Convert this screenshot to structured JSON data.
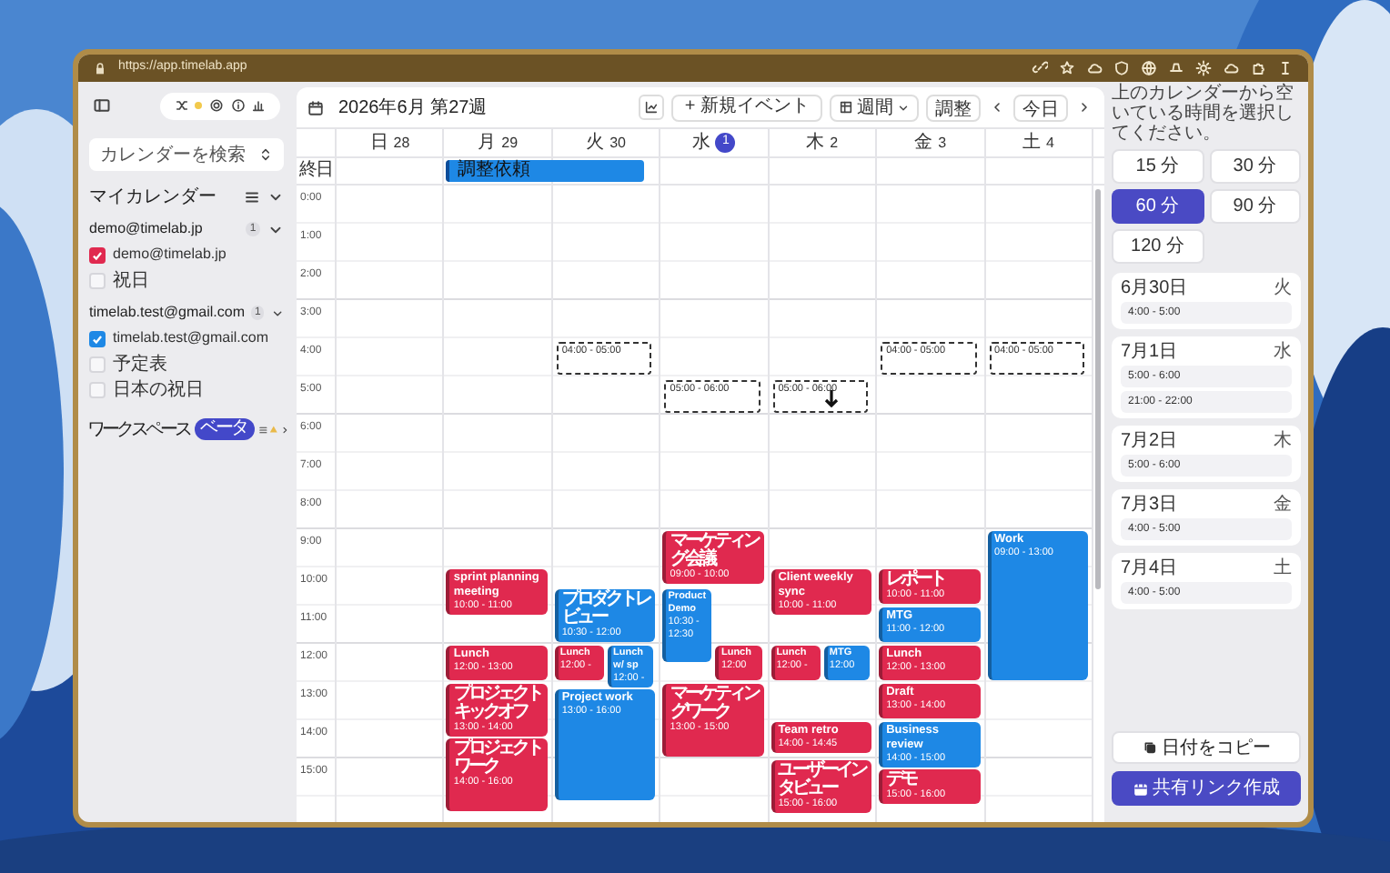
{
  "browser": {
    "url": "https://app.timelab.app"
  },
  "sidebar": {
    "search": {
      "placeholder": "カレンダーを検索"
    },
    "my_calendars": "マイカレンダー",
    "accounts": [
      {
        "email": "demo@timelab.jp",
        "count": "1",
        "expanded": true,
        "calendars": [
          {
            "name": "demo@timelab.jp",
            "checked": true,
            "color": "#e0294f"
          },
          {
            "name": "祝日",
            "checked": false
          }
        ]
      },
      {
        "email": "timelab.test@gmail.com",
        "count": "1",
        "expanded": true,
        "calendars": [
          {
            "name": "timelab.test@gmail.com",
            "checked": true,
            "color": "#1e88e5"
          },
          {
            "name": "予定表",
            "checked": false
          },
          {
            "name": "日本の祝日",
            "checked": false
          }
        ]
      }
    ],
    "workspace": {
      "label": "ワークスペース",
      "badge": "ベータ"
    }
  },
  "calendar": {
    "title": "2026年6月 第27週",
    "toolbar": {
      "new_event": "+ 新規イベント",
      "view": "週間",
      "adjust": "調整",
      "today": "今日"
    },
    "all_day_label": "終日",
    "hours": [
      "0:00",
      "1:00",
      "2:00",
      "3:00",
      "4:00",
      "5:00",
      "6:00",
      "7:00",
      "8:00",
      "9:00",
      "10:00",
      "11:00",
      "12:00",
      "13:00",
      "14:00",
      "15:00"
    ],
    "days": [
      {
        "weekday": "日",
        "date": "28",
        "today": false
      },
      {
        "weekday": "月",
        "date": "29",
        "today": false,
        "all_day": [
          {
            "title": "調整依頼",
            "color": "#1e88e5",
            "continues": true
          }
        ],
        "events": [
          {
            "title": "sprint planning meeting",
            "time": "10:00 - 11:00",
            "kind": "full",
            "color": "#e0294f"
          },
          {
            "title": "Lunch",
            "time": "12:00 - 13:00",
            "kind": "full",
            "color": "#e0294f"
          },
          {
            "title": "プロジェクトキックオフ",
            "time": "13:00 - 14:00",
            "kind": "full",
            "color": "#e0294f"
          },
          {
            "title": "プロジェクトワーク",
            "time": "14:00 - 16:00",
            "kind": "full",
            "color": "#e0294f"
          }
        ]
      },
      {
        "weekday": "火",
        "date": "30",
        "today": false,
        "slots": [
          {
            "label": "04:00 - 05:00",
            "hovered": false
          }
        ],
        "events": [
          {
            "title": "プロダクトレビュー",
            "time": "10:30 - 12:00",
            "kind": "full",
            "color": "#1e88e5"
          },
          {
            "title": "Lunch",
            "time": "12:00 -",
            "kind": "left",
            "color": "#e0294f"
          },
          {
            "title": "Lunch w/ sp",
            "time": "12:00 -",
            "kind": "right",
            "color": "#1e88e5"
          },
          {
            "title": "Project work",
            "time": "13:00 - 16:00",
            "kind": "full",
            "color": "#1e88e5"
          }
        ]
      },
      {
        "weekday": "水",
        "date": "1",
        "today": true,
        "slots": [
          {
            "label": "05:00 - 06:00",
            "hovered": false
          }
        ],
        "events": [
          {
            "title": "マーケティング会議",
            "time": "09:00 - 10:00",
            "kind": "full",
            "color": "#e0294f"
          },
          {
            "title": "Product Demo",
            "time": "10:30 - 12:30",
            "kind": "left",
            "color": "#1e88e5"
          },
          {
            "title": "Lunch",
            "time": "12:00",
            "kind": "right",
            "color": "#e0294f"
          },
          {
            "title": "マーケティングワーク",
            "time": "13:00 - 15:00",
            "kind": "full",
            "color": "#e0294f"
          }
        ]
      },
      {
        "weekday": "木",
        "date": "2",
        "today": false,
        "slots": [
          {
            "label": "05:00 - 06:00",
            "hovered": true
          }
        ],
        "events": [
          {
            "title": "Client weekly sync",
            "time": "10:00 - 11:00",
            "kind": "full",
            "color": "#e0294f"
          },
          {
            "title": "Lunch",
            "time": "12:00 -",
            "kind": "left",
            "color": "#e0294f"
          },
          {
            "title": "MTG",
            "time": "12:00",
            "kind": "right",
            "color": "#1e88e5"
          },
          {
            "title": "Team retro",
            "time": "14:00 - 14:45",
            "kind": "full",
            "color": "#e0294f"
          },
          {
            "title": "ユーザーインタビュー",
            "time": "15:00 - 16:00",
            "kind": "full",
            "color": "#e0294f"
          }
        ]
      },
      {
        "weekday": "金",
        "date": "3",
        "today": false,
        "slots": [
          {
            "label": "04:00 - 05:00",
            "hovered": false
          }
        ],
        "events": [
          {
            "title": "レポート",
            "time": "10:00 - 11:00",
            "kind": "full",
            "color": "#e0294f"
          },
          {
            "title": "MTG",
            "time": "11:00 - 12:00",
            "kind": "full",
            "color": "#1e88e5"
          },
          {
            "title": "Lunch",
            "time": "12:00 - 13:00",
            "kind": "full",
            "color": "#e0294f"
          },
          {
            "title": "Draft",
            "time": "13:00 - 14:00",
            "kind": "full",
            "color": "#e0294f"
          },
          {
            "title": "Business review",
            "time": "14:00 - 15:00",
            "kind": "full",
            "color": "#1e88e5"
          },
          {
            "title": "デモ",
            "time": "15:00 - 16:00",
            "kind": "full",
            "color": "#e0294f"
          }
        ]
      },
      {
        "weekday": "土",
        "date": "4",
        "today": false,
        "slots": [
          {
            "label": "04:00 - 05:00",
            "hovered": false
          }
        ],
        "events": [
          {
            "title": "Work",
            "time": "09:00 - 13:00",
            "kind": "full",
            "color": "#1e88e5"
          }
        ]
      }
    ]
  },
  "scheduler": {
    "hint": "上のカレンダーから空いている時間を選択してください。",
    "durations": [
      {
        "label": "15 分",
        "selected": false
      },
      {
        "label": "30 分",
        "selected": false
      },
      {
        "label": "60 分",
        "selected": true
      },
      {
        "label": "90 分",
        "selected": false
      },
      {
        "label": "120 分",
        "selected": false
      }
    ],
    "days": [
      {
        "date": "6月30日",
        "weekday": "火",
        "slots": [
          "4:00 - 5:00"
        ]
      },
      {
        "date": "7月1日",
        "weekday": "水",
        "slots": [
          "5:00 - 6:00",
          "21:00 - 22:00"
        ]
      },
      {
        "date": "7月2日",
        "weekday": "木",
        "slots": [
          "5:00 - 6:00"
        ]
      },
      {
        "date": "7月3日",
        "weekday": "金",
        "slots": [
          "4:00 - 5:00"
        ]
      },
      {
        "date": "7月4日",
        "weekday": "土",
        "slots": [
          "4:00 - 5:00"
        ]
      }
    ],
    "copy_button": "日付をコピー",
    "create_button": "共有リンク作成"
  }
}
